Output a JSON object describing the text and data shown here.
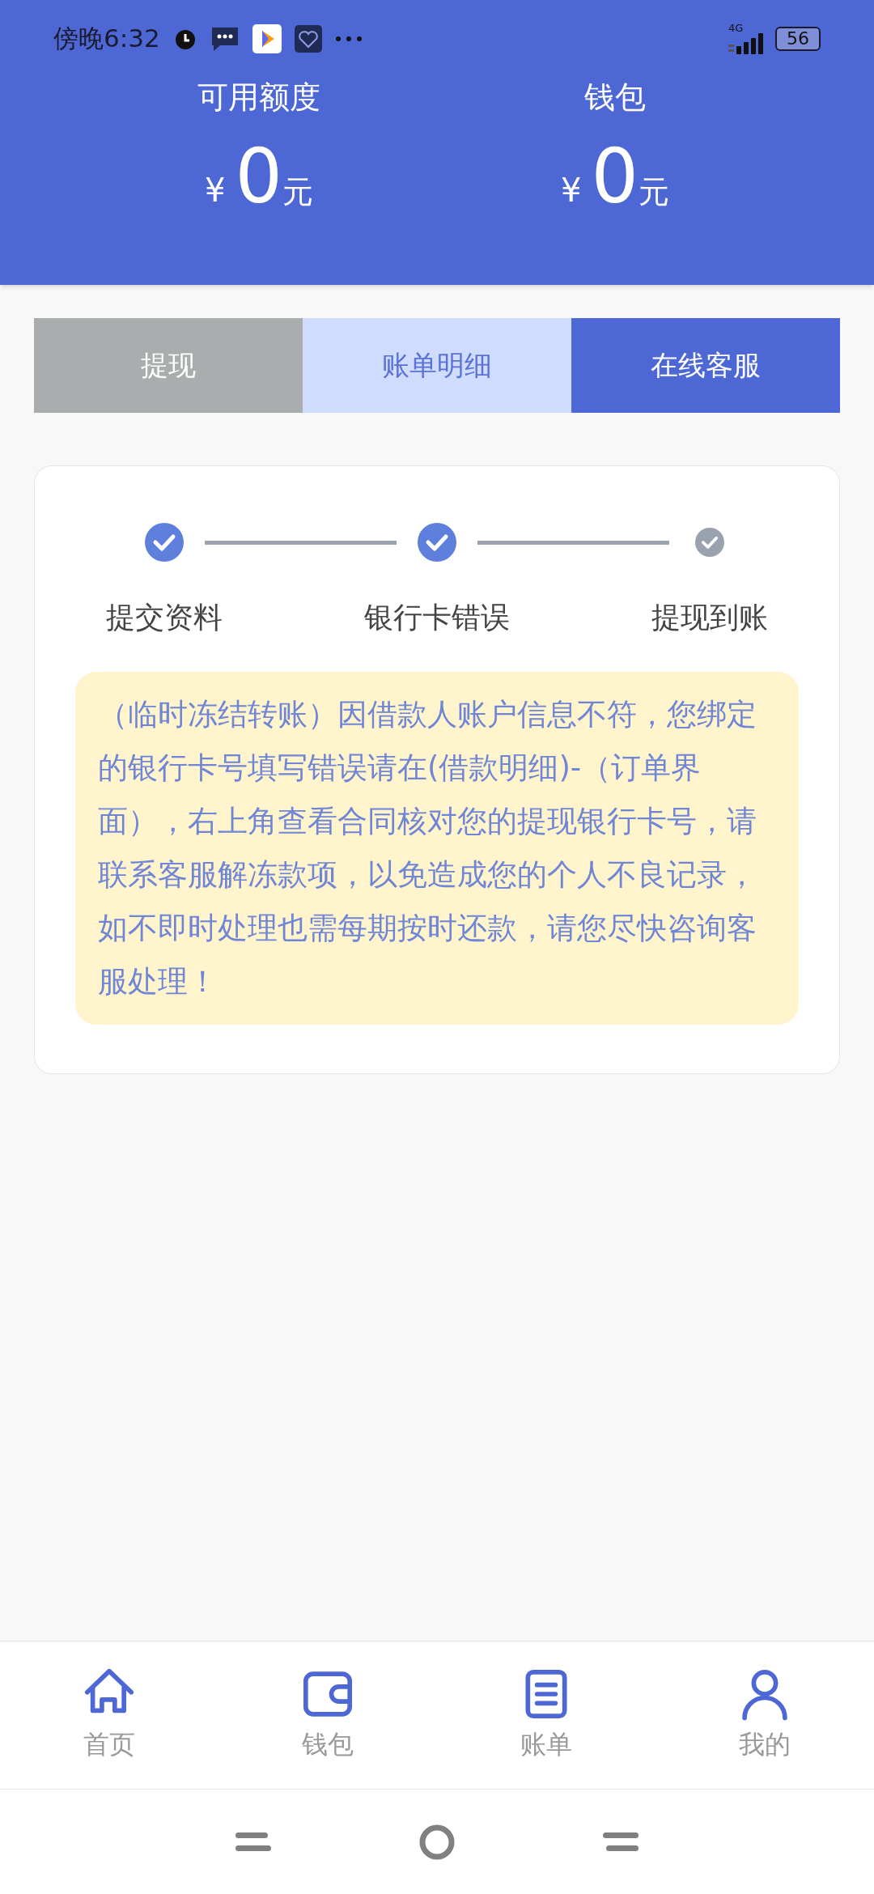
{
  "status_bar": {
    "time": "傍晚6:32",
    "network": "4G",
    "battery": "56"
  },
  "balances": [
    {
      "label": "可用额度",
      "currency": "¥",
      "amount": "0",
      "unit": "元"
    },
    {
      "label": "钱包",
      "currency": "¥",
      "amount": "0",
      "unit": "元"
    }
  ],
  "actions": [
    {
      "label": "提现",
      "kind": "muted"
    },
    {
      "label": "账单明细",
      "kind": "light"
    },
    {
      "label": "在线客服",
      "kind": "primary"
    }
  ],
  "steps": [
    {
      "label": "提交资料",
      "done": true
    },
    {
      "label": "银行卡错误",
      "done": true
    },
    {
      "label": "提现到账",
      "done": false
    }
  ],
  "notice": "（临时冻结转账）因借款人账户信息不符，您绑定的银行卡号填写错误请在(借款明细)-（订单界面），右上角查看合同核对您的提现银行卡号，请联系客服解冻款项，以免造成您的个人不良记录，如不即时处理也需每期按时还款，请您尽快咨询客服处理！",
  "bottom_nav": [
    {
      "label": "首页"
    },
    {
      "label": "钱包"
    },
    {
      "label": "账单"
    },
    {
      "label": "我的"
    }
  ]
}
